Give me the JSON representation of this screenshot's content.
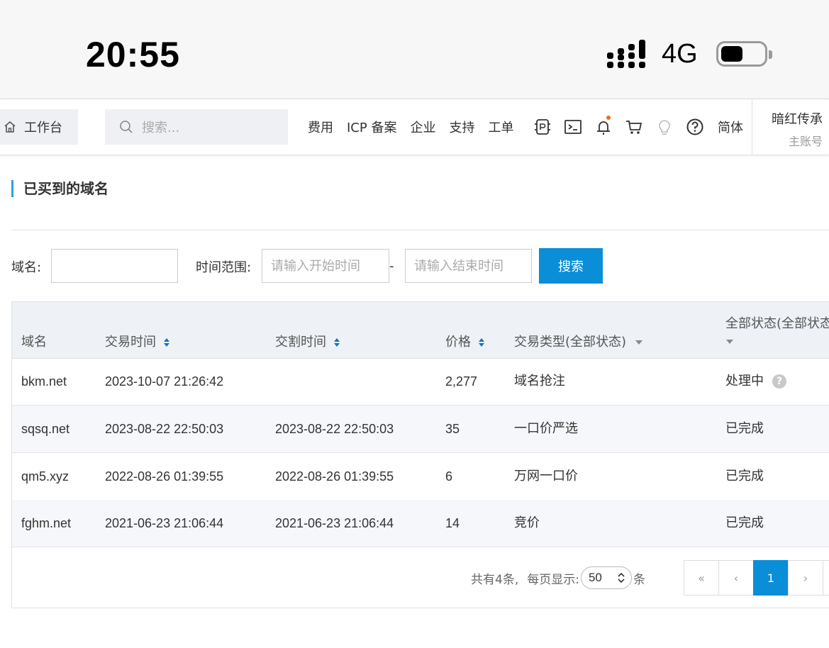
{
  "status_bar": {
    "time": "20:55",
    "network": "4G"
  },
  "topnav": {
    "workbench": "工作台",
    "search_placeholder": "搜索...",
    "links": [
      "费用",
      "ICP 备案",
      "企业",
      "支持",
      "工单"
    ],
    "icons": [
      "app-icon",
      "terminal-icon",
      "bell-icon",
      "cart-icon",
      "lightbulb-icon",
      "help-circle-icon"
    ],
    "language": "简体",
    "account_name": "暗红传承",
    "account_role": "主账号"
  },
  "page_title": "已买到的域名",
  "filters": {
    "domain_label": "域名:",
    "domain_value": "",
    "time_label": "时间范围:",
    "start_placeholder": "请输入开始时间",
    "range_sep": "-",
    "end_placeholder": "请输入结束时间",
    "search_button": "搜索"
  },
  "table": {
    "headers": {
      "domain": "域名",
      "trade_time": "交易时间",
      "delivery_time": "交割时间",
      "price": "价格",
      "trade_type": "交易类型(全部状态)",
      "status": "全部状态(全部状态"
    },
    "rows": [
      {
        "domain": "bkm.net",
        "trade_time": "2023-10-07 21:26:42",
        "delivery_time": "",
        "price": "2,277",
        "trade_type": "域名抢注",
        "status": "处理中",
        "help": "?"
      },
      {
        "domain": "sqsq.net",
        "trade_time": "2023-08-22 22:50:03",
        "delivery_time": "2023-08-22 22:50:03",
        "price": "35",
        "trade_type": "一口价严选",
        "status": "已完成"
      },
      {
        "domain": "qm5.xyz",
        "trade_time": "2022-08-26 01:39:55",
        "delivery_time": "2022-08-26 01:39:55",
        "price": "6",
        "trade_type": "万网一口价",
        "status": "已完成"
      },
      {
        "domain": "fghm.net",
        "trade_time": "2021-06-23 21:06:44",
        "delivery_time": "2021-06-23 21:06:44",
        "price": "14",
        "trade_type": "竞价",
        "status": "已完成"
      }
    ]
  },
  "pagination": {
    "total_text": "共有4条,",
    "per_page_label": "每页显示:",
    "page_size": "50",
    "unit": "条",
    "first": "«",
    "prev": "‹",
    "current": "1",
    "next": "›",
    "last": "»"
  },
  "colors": {
    "accent": "#0a8ed8",
    "notification_dot": "#f56c1c"
  }
}
